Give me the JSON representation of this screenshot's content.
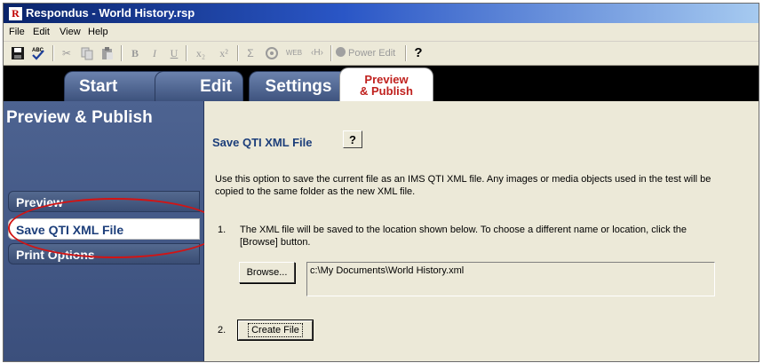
{
  "window": {
    "title": "Respondus - World History.rsp",
    "icon_letter": "R"
  },
  "menu": [
    "File",
    "Edit",
    "View",
    "Help"
  ],
  "toolbar": {
    "power_edit_label": "Power Edit",
    "help_glyph": "?",
    "bold_glyph": "B",
    "italic_glyph": "I",
    "underline_glyph": "U",
    "subscript_glyph": "x₂",
    "superscript_glyph": "x²",
    "sigma_glyph": "Σ",
    "web_glyph": "WEB",
    "html_glyph": "‹H›"
  },
  "tabs": {
    "start": "Start",
    "edit": "Edit",
    "settings": "Settings",
    "preview_line1": "Preview",
    "preview_line2": "& Publish"
  },
  "sidebar": {
    "title": "Preview & Publish",
    "items": [
      {
        "label": "Preview"
      },
      {
        "label": "Save QTI XML File"
      },
      {
        "label": "Print Options"
      }
    ]
  },
  "main": {
    "title": "Save QTI XML File",
    "help_label": "?",
    "description": "Use this option to save the current file as an IMS QTI XML file.  Any images or media objects used in the test will be copied to the same folder as the new XML file.",
    "step1_num": "1.",
    "step1_text": "The XML file will be saved to the location shown below.  To choose a different name or location, click the [Browse] button.",
    "browse_label": "Browse...",
    "path_value": "c:\\My Documents\\World History.xml",
    "step2_num": "2.",
    "create_label": "Create File"
  },
  "colors": {
    "annotation": "#d21414",
    "accent": "#1c3e7a",
    "active_tab_text": "#c0211e"
  }
}
